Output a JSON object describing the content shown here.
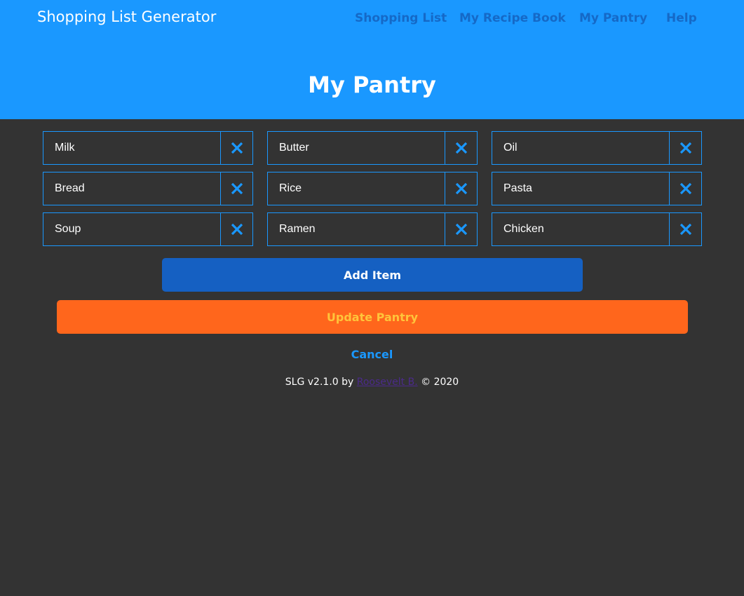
{
  "header": {
    "brand": "Shopping List Generator",
    "nav": [
      "Shopping List",
      "My Recipe Book",
      "My Pantry",
      "Help"
    ],
    "page_title": "My Pantry"
  },
  "pantry": {
    "items": [
      "Milk",
      "Butter",
      "Oil",
      "Bread",
      "Rice",
      "Pasta",
      "Soup",
      "Ramen",
      "Chicken"
    ]
  },
  "actions": {
    "add_item": "Add Item",
    "update_pantry": "Update Pantry",
    "cancel": "Cancel"
  },
  "footer": {
    "prefix": "SLG v2.1.0 by",
    "author": "Roosevelt B.",
    "suffix": "© 2020"
  },
  "icons": {
    "remove": "close-icon"
  },
  "colors": {
    "header_bg": "#1a98ff",
    "page_bg": "#333333",
    "nav_link": "#1569c7",
    "accent": "#1a98ff",
    "add_button": "#1560c2",
    "update_button": "#ff661c",
    "update_text": "#ffc43a"
  }
}
